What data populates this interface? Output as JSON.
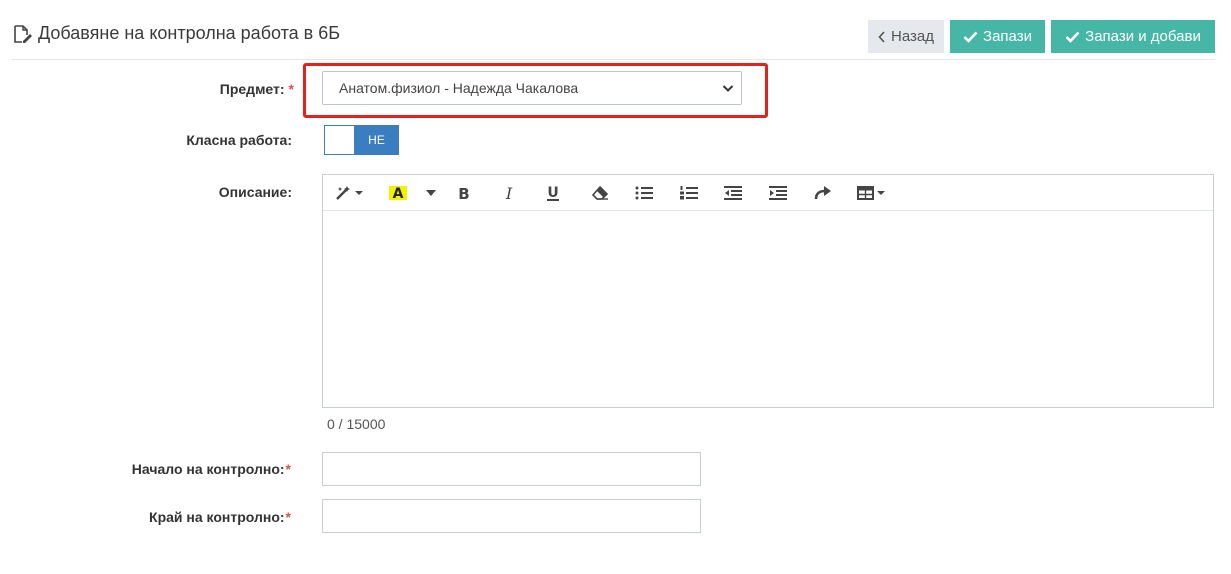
{
  "header": {
    "title": "Добавяне на контролна работа в 6Б",
    "buttons": {
      "back_label": "Назад",
      "save_label": "Запази",
      "save_add_label": "Запази и добави"
    }
  },
  "form": {
    "subject": {
      "label": "Предмет:",
      "required_mark": "*",
      "selected_value": "Анатом.физиол - Надежда Чакалова"
    },
    "class_work": {
      "label": "Класна работа:",
      "toggle_state": "НЕ"
    },
    "description": {
      "label": "Описание:",
      "counter": "0 / 15000",
      "toolbar_icons": [
        "magic-wand-icon",
        "font-color-icon",
        "bold-icon",
        "italic-icon",
        "underline-icon",
        "eraser-icon",
        "bullet-list-icon",
        "numbered-list-icon",
        "outdent-icon",
        "indent-icon",
        "redo-icon",
        "table-icon"
      ],
      "highlight_color": "#f2f200"
    },
    "start": {
      "label": "Начало на контролно:",
      "required_mark": "*",
      "value": ""
    },
    "end": {
      "label": "Край на контролно:",
      "required_mark": "*",
      "value": ""
    }
  },
  "colors": {
    "accent_green": "#46b6a7",
    "toggle_blue": "#3b7dc1",
    "highlight_red": "#e0241b"
  }
}
